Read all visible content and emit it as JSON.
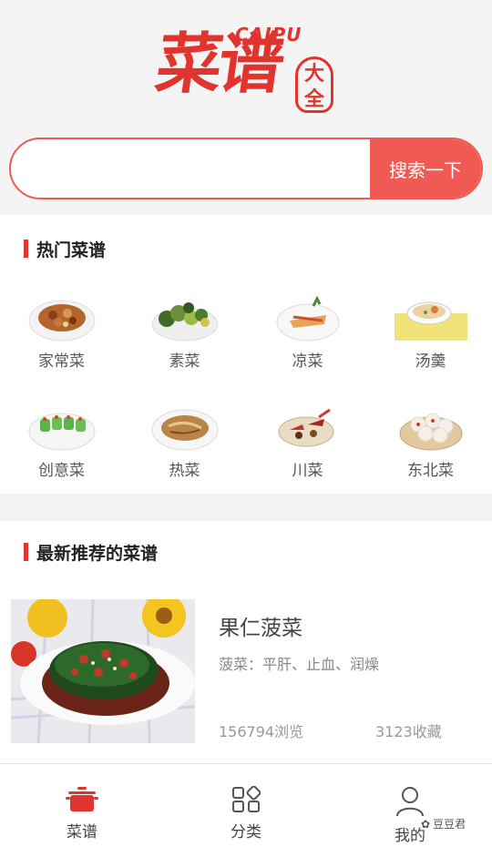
{
  "header": {
    "logo_main": "菜谱",
    "logo_caipu": "CAIPU",
    "logo_seal": "大全"
  },
  "search": {
    "value": "",
    "placeholder": "",
    "button_label": "搜索一下"
  },
  "hot": {
    "title": "热门菜谱",
    "items": [
      {
        "label": "家常菜",
        "icon": "home-dish-icon"
      },
      {
        "label": "素菜",
        "icon": "vegetable-dish-icon"
      },
      {
        "label": "凉菜",
        "icon": "cold-dish-icon"
      },
      {
        "label": "汤羹",
        "icon": "soup-icon"
      },
      {
        "label": "创意菜",
        "icon": "creative-dish-icon"
      },
      {
        "label": "热菜",
        "icon": "hot-dish-icon"
      },
      {
        "label": "川菜",
        "icon": "sichuan-dish-icon"
      },
      {
        "label": "东北菜",
        "icon": "northeast-dish-icon"
      }
    ]
  },
  "latest": {
    "title": "最新推荐的菜谱",
    "recipe": {
      "name": "果仁菠菜",
      "desc": "菠菜：平肝、止血、润燥",
      "views": "156794浏览",
      "favorites": "3123收藏"
    }
  },
  "tabbar": {
    "items": [
      {
        "label": "菜谱",
        "icon": "pot-icon",
        "active": true
      },
      {
        "label": "分类",
        "icon": "category-grid-icon",
        "active": false
      },
      {
        "label": "我的",
        "icon": "user-icon",
        "active": false
      }
    ]
  },
  "watermark": {
    "text": "豆豆君"
  },
  "colors": {
    "accent": "#e0342f",
    "button": "#f05a55"
  }
}
